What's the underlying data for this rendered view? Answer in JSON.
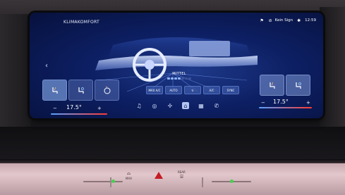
{
  "screen": {
    "title": "KLIMAKOMFORT",
    "status": {
      "signal_label": "Kein Sign",
      "clock": "12:59"
    }
  },
  "climate": {
    "fan_label": "MITTEL",
    "fan_level": 0.6,
    "controls": [
      "MAX A/C",
      "AUTO",
      "",
      "A/C",
      "SYNC"
    ],
    "left_temp": "17.5°",
    "right_temp": "17.5°",
    "minus": "−",
    "plus": "+"
  },
  "hardware": {
    "max_label": "MAX",
    "rear_label": "REAR"
  },
  "colors": {
    "accent": "#8fb4ff",
    "screen_bg": "#0d1f63",
    "hazard": "#c41c24",
    "temp_cold": "#5aa0ff",
    "temp_hot": "#ff3b30"
  }
}
